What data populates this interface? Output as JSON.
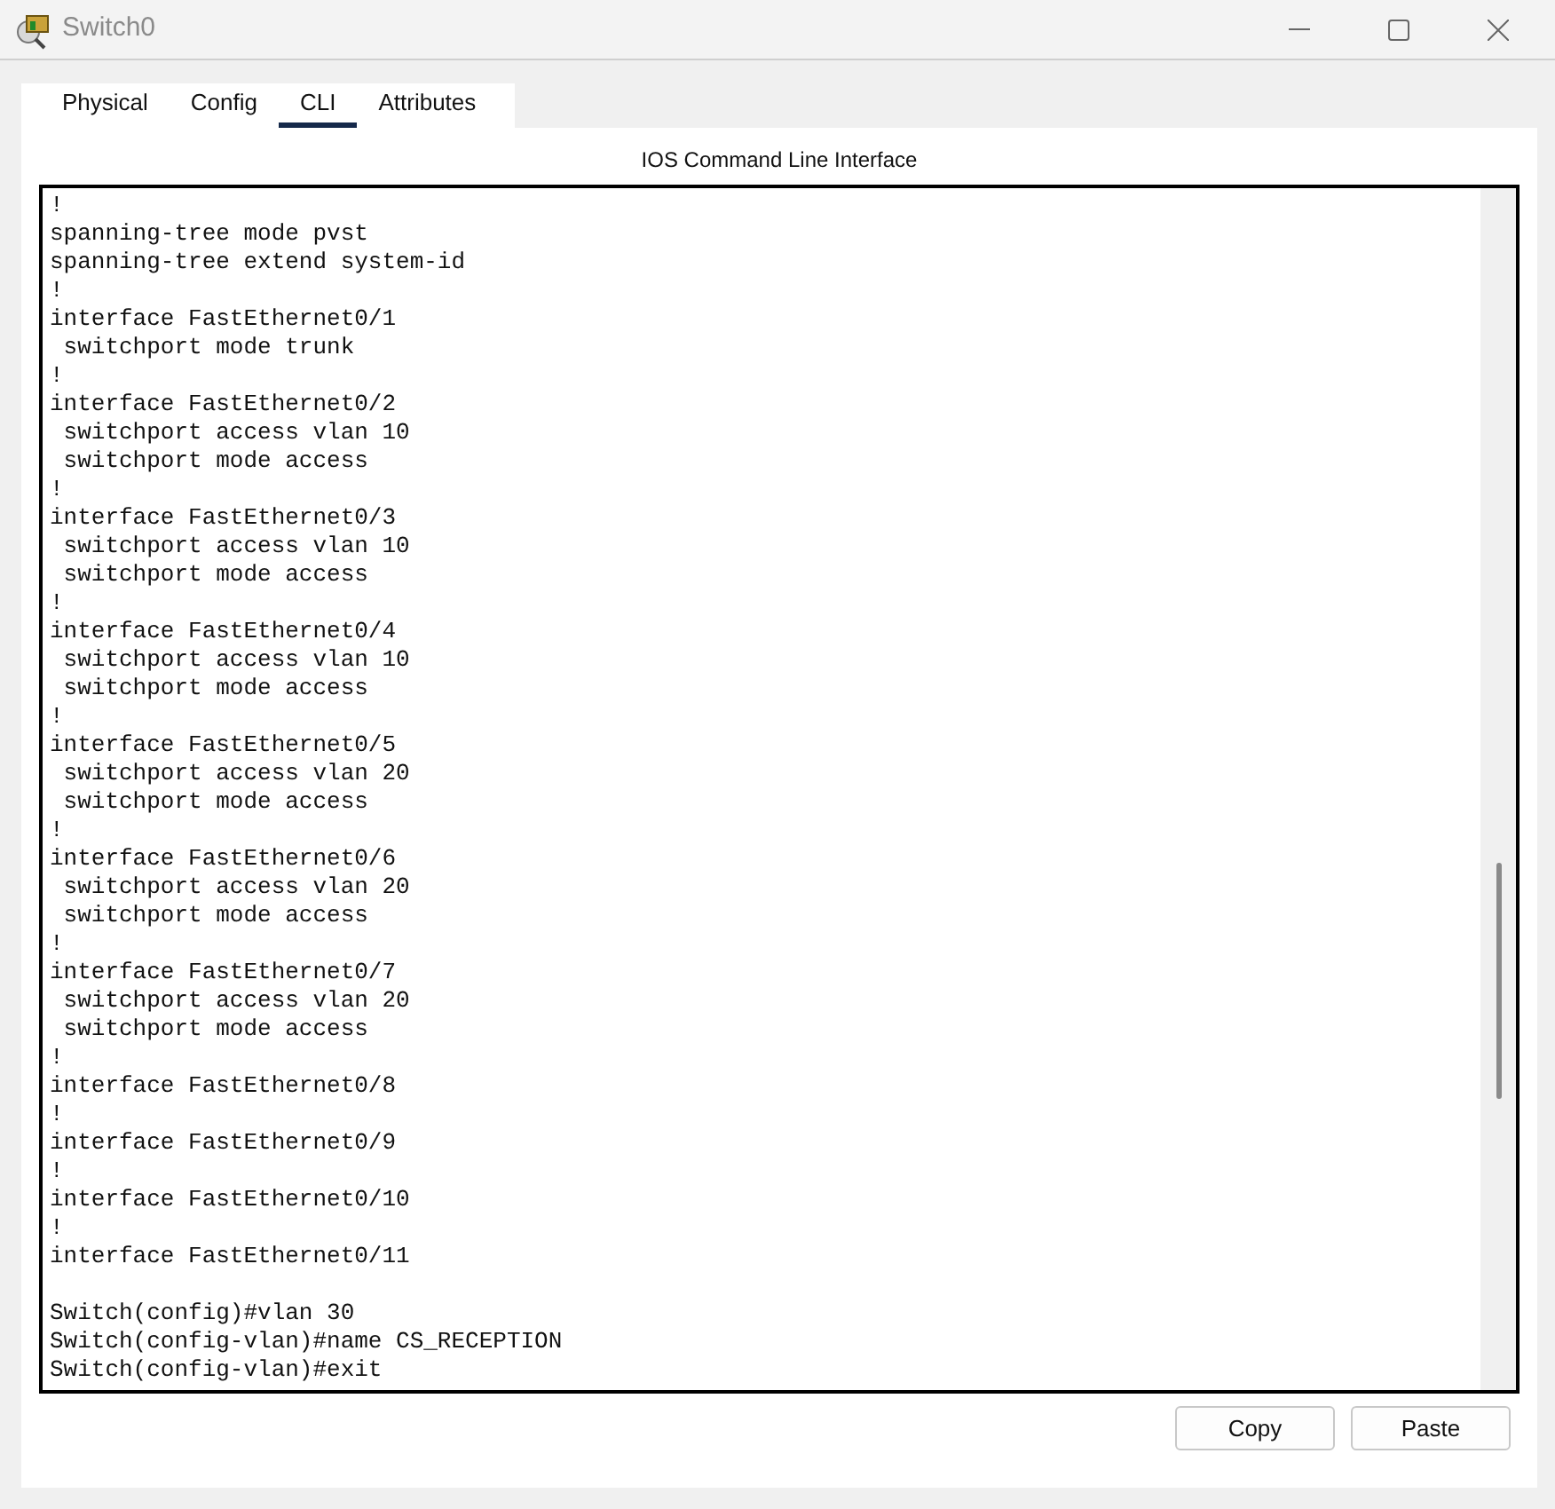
{
  "window": {
    "title": "Switch0"
  },
  "tabs": [
    {
      "label": "Physical",
      "selected": false
    },
    {
      "label": "Config",
      "selected": false
    },
    {
      "label": "CLI",
      "selected": true
    },
    {
      "label": "Attributes",
      "selected": false
    }
  ],
  "cli": {
    "heading": "IOS Command Line Interface",
    "blocks": [
      [
        "!",
        "spanning-tree mode pvst",
        "spanning-tree extend system-id",
        "!",
        "interface FastEthernet0/1",
        " switchport mode trunk",
        "!",
        "interface FastEthernet0/2",
        " switchport access vlan 10",
        " switchport mode access",
        "!",
        "interface FastEthernet0/3",
        " switchport access vlan 10",
        " switchport mode access",
        "!",
        "interface FastEthernet0/4",
        " switchport access vlan 10",
        " switchport mode access",
        "!",
        "interface FastEthernet0/5",
        " switchport access vlan 20",
        " switchport mode access",
        "!",
        "interface FastEthernet0/6",
        " switchport access vlan 20",
        " switchport mode access",
        "!",
        "interface FastEthernet0/7",
        " switchport access vlan 20",
        " switchport mode access",
        "!",
        "interface FastEthernet0/8",
        "!",
        "interface FastEthernet0/9",
        "!",
        "interface FastEthernet0/10",
        "!",
        "interface FastEthernet0/11"
      ],
      [
        "Switch(config)#vlan 30",
        "Switch(config-vlan)#name CS_RECEPTION",
        "Switch(config-vlan)#exit"
      ]
    ]
  },
  "buttons": [
    "Copy",
    "Paste"
  ]
}
